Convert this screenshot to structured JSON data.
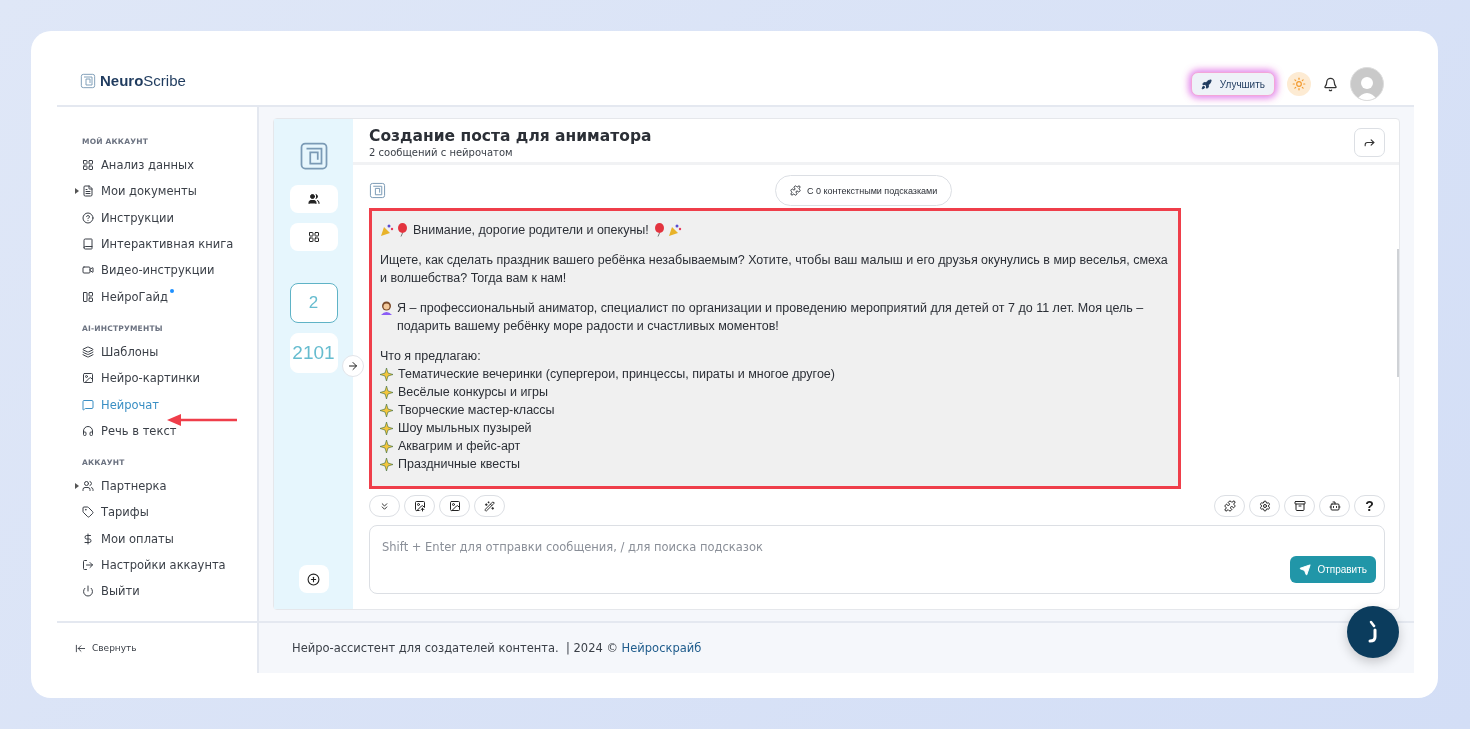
{
  "header": {
    "brand_bold": "Neuro",
    "brand_light": "Scribe",
    "upgrade_button": "Улучшить"
  },
  "sidebar": {
    "sections": [
      {
        "title": "МОЙ АККАУНТ",
        "items": [
          {
            "label": "Анализ данных",
            "collapsible": false,
            "selected": false,
            "new_dot": false
          },
          {
            "label": "Мои документы",
            "collapsible": true,
            "selected": false,
            "new_dot": false
          },
          {
            "label": "Инструкции",
            "collapsible": false,
            "selected": false,
            "new_dot": false
          },
          {
            "label": "Интерактивная книга",
            "collapsible": false,
            "selected": false,
            "new_dot": false
          },
          {
            "label": "Видео-инструкции",
            "collapsible": false,
            "selected": false,
            "new_dot": false
          },
          {
            "label": "НейроГайд",
            "collapsible": false,
            "selected": false,
            "new_dot": true
          }
        ]
      },
      {
        "title": "AI-ИНСТРУМЕНТЫ",
        "items": [
          {
            "label": "Шаблоны",
            "collapsible": false,
            "selected": false,
            "new_dot": false
          },
          {
            "label": "Нейро-картинки",
            "collapsible": false,
            "selected": false,
            "new_dot": false
          },
          {
            "label": "Нейрочат",
            "collapsible": false,
            "selected": true,
            "new_dot": false
          },
          {
            "label": "Речь в текст",
            "collapsible": false,
            "selected": false,
            "new_dot": false
          }
        ]
      },
      {
        "title": "АККАУНТ",
        "items": [
          {
            "label": "Партнерка",
            "collapsible": true,
            "selected": false,
            "new_dot": false
          },
          {
            "label": "Тарифы",
            "collapsible": false,
            "selected": false,
            "new_dot": false
          },
          {
            "label": "Мои оплаты",
            "collapsible": false,
            "selected": false,
            "new_dot": false
          },
          {
            "label": "Настройки аккаунта",
            "collapsible": false,
            "selected": false,
            "new_dot": false
          },
          {
            "label": "Выйти",
            "collapsible": false,
            "selected": false,
            "new_dot": false
          }
        ]
      }
    ],
    "collapse_button": "Свернуть"
  },
  "rail": {
    "counters": [
      {
        "label": "2",
        "selected": true
      },
      {
        "label": "2101",
        "selected": false
      }
    ]
  },
  "chat": {
    "title": "Создание поста для аниматора",
    "subtitle": "2 сообщений с нейрочатом",
    "context_pill": "С 0 контекстными подсказками",
    "message": {
      "heading": "Внимание, дорогие родители и опекуны!",
      "paragraphs": [
        "Ищете, как сделать праздник вашего ребёнка незабываемым? Хотите, чтобы ваш малыш и его друзья окунулись в мир веселья, смеха и волшебства? Тогда вам к нам!",
        "Я – профессиональный аниматор, специалист по организации и проведению мероприятий для детей от 7 до 11 лет. Моя цель – подарить вашему ребёнку море радости и счастливых моментов!"
      ],
      "list_title": "Что я предлагаю:",
      "list_items": [
        "Тематические вечеринки (супергерои, принцессы, пираты и многое другое)",
        "Весёлые конкурсы и игры",
        "Творческие мастер-классы",
        "Шоу мыльных пузырей",
        "Аквагрим и фейс-арт",
        "Праздничные квесты"
      ]
    },
    "help_label": "?",
    "input": {
      "placeholder": "Shift + Enter для отправки сообщения, / для поиска подсказок"
    },
    "send_button": "Отправить"
  },
  "footer": {
    "text": "Нейро-ассистент для создателей контента.  | 2024 © ",
    "link": "Нейроскрайб"
  }
}
